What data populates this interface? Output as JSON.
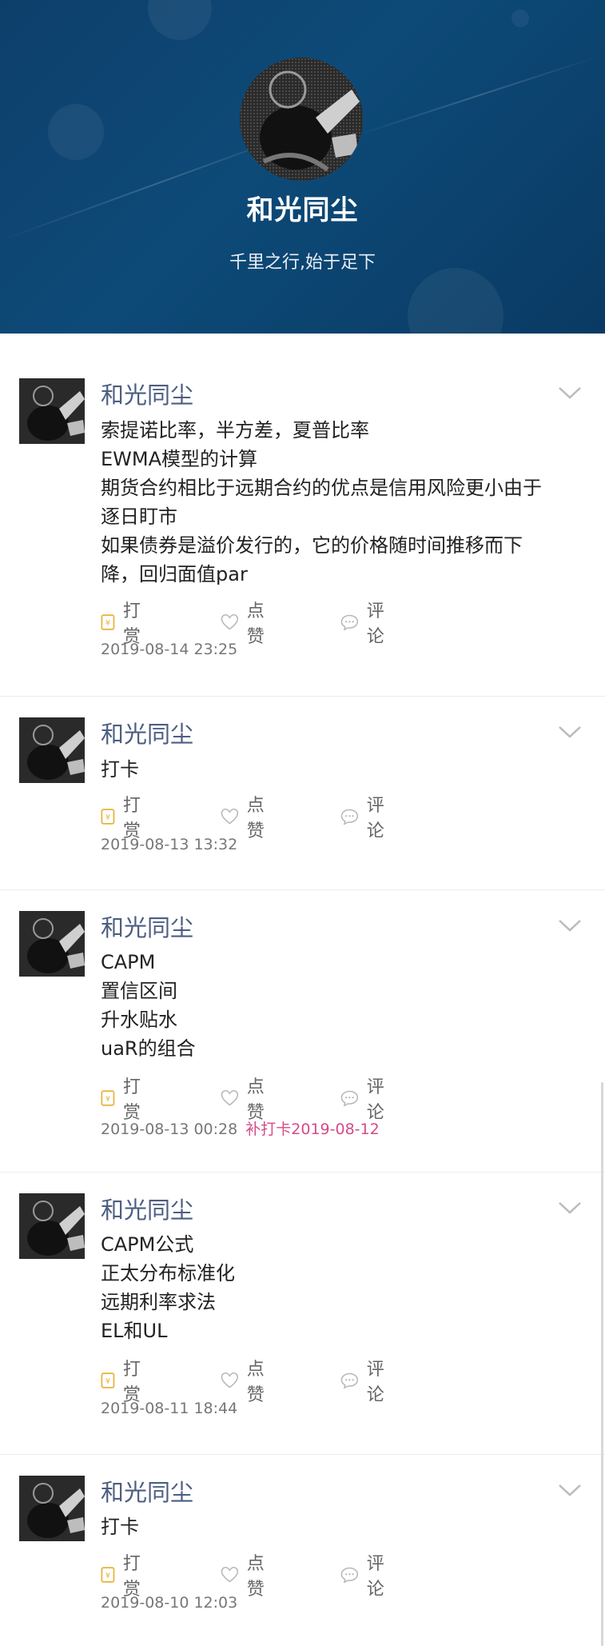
{
  "profile": {
    "name": "和光同尘",
    "motto": "千里之行,始于足下"
  },
  "actions": {
    "reward": "打赏",
    "like": "点赞",
    "comment": "评论"
  },
  "posts": [
    {
      "author": "和光同尘",
      "lines": [
        "索提诺比率，半方差，夏普比率",
        "EWMA模型的计算",
        "期货合约相比于远期合约的优点是信用风险更小由于",
        "逐日盯市",
        "如果债券是溢价发行的，它的价格随时间推移而下",
        "降，回归面值par"
      ],
      "timestamp": "2019-08-14 23:25",
      "makeup": ""
    },
    {
      "author": "和光同尘",
      "lines": [
        "打卡"
      ],
      "timestamp": "2019-08-13 13:32",
      "makeup": ""
    },
    {
      "author": "和光同尘",
      "lines": [
        "CAPM",
        "置信区间",
        "升水贴水",
        "uaR的组合"
      ],
      "timestamp": "2019-08-13 00:28",
      "makeup": "补打卡2019-08-12"
    },
    {
      "author": "和光同尘",
      "lines": [
        "CAPM公式",
        "正太分布标准化",
        "远期利率求法",
        "EL和UL"
      ],
      "timestamp": "2019-08-11 18:44",
      "makeup": ""
    },
    {
      "author": "和光同尘",
      "lines": [
        "打卡"
      ],
      "timestamp": "2019-08-10 12:03",
      "makeup": ""
    }
  ]
}
